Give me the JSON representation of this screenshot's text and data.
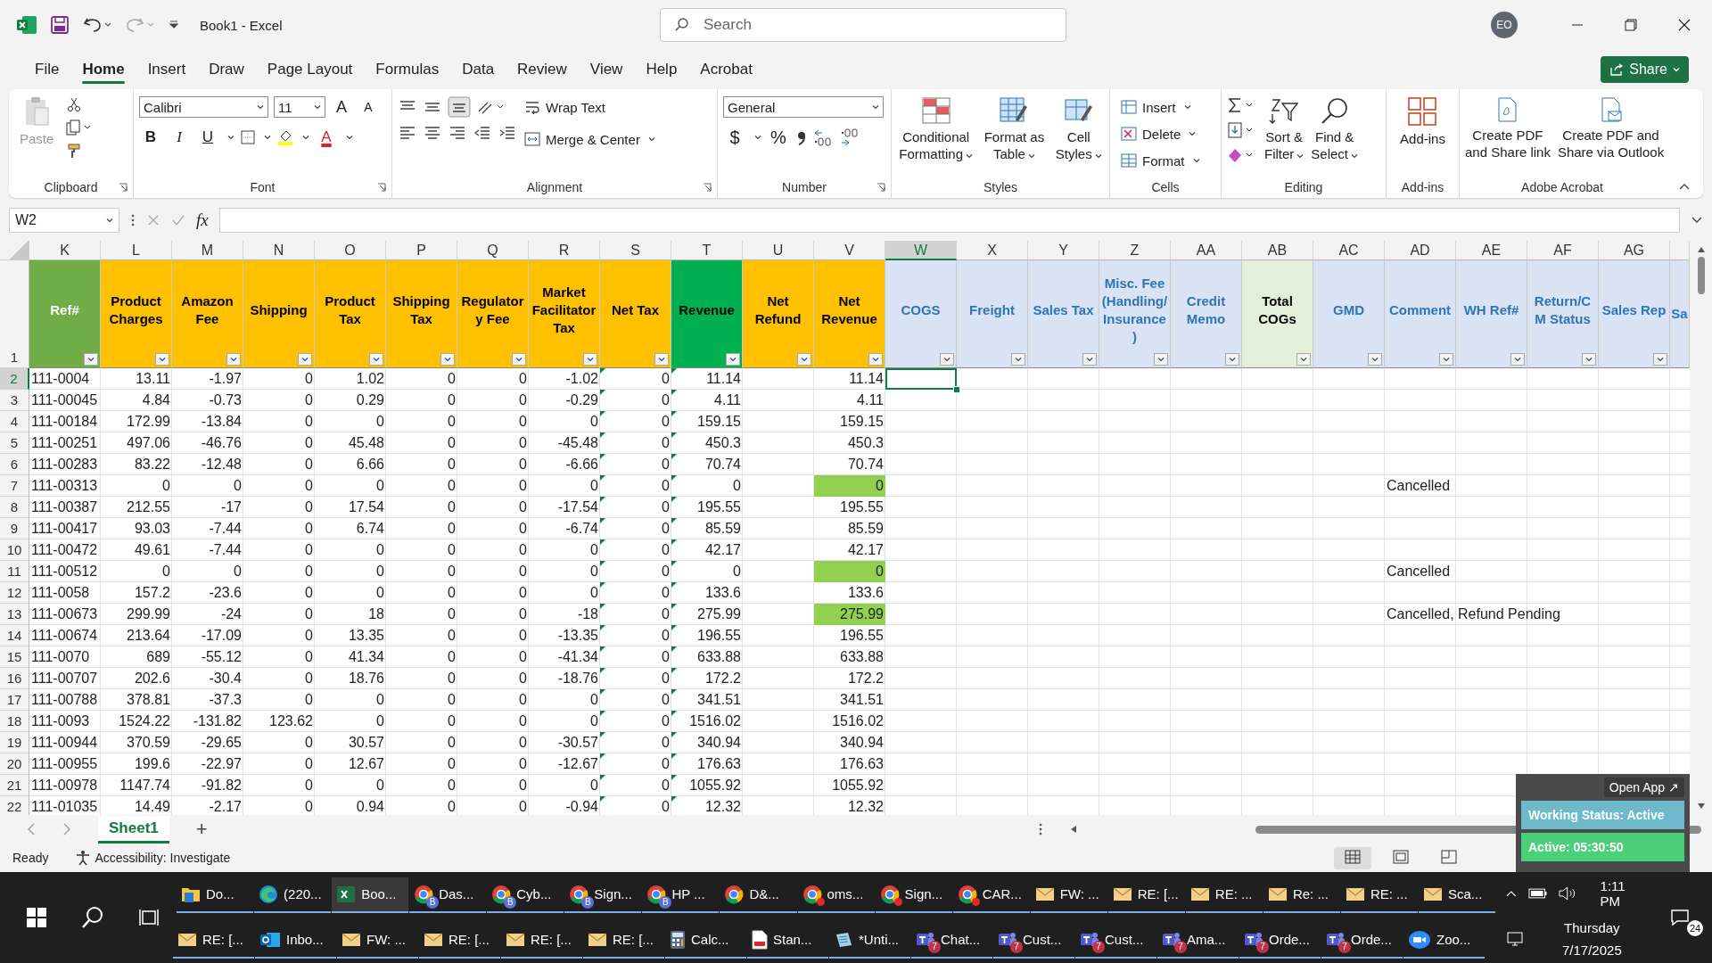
{
  "title_bar": {
    "title": "Book1  -  Excel",
    "search_placeholder": "Search",
    "avatar": "EO"
  },
  "menu_tabs": [
    {
      "label": "File",
      "selected": false
    },
    {
      "label": "Home",
      "selected": true
    },
    {
      "label": "Insert",
      "selected": false
    },
    {
      "label": "Draw",
      "selected": false
    },
    {
      "label": "Page Layout",
      "selected": false
    },
    {
      "label": "Formulas",
      "selected": false
    },
    {
      "label": "Data",
      "selected": false
    },
    {
      "label": "Review",
      "selected": false
    },
    {
      "label": "View",
      "selected": false
    },
    {
      "label": "Help",
      "selected": false
    },
    {
      "label": "Acrobat",
      "selected": false
    }
  ],
  "share": "Share",
  "ribbon": {
    "clipboard": {
      "label": "Clipboard",
      "paste": "Paste"
    },
    "font": {
      "label": "Font",
      "family": "Calibri",
      "size": "11",
      "grow": "A",
      "shrink": "A",
      "bold": "B",
      "italic": "I",
      "underline": "U",
      "font_color": "A"
    },
    "alignment": {
      "label": "Alignment",
      "wrap_text": "Wrap Text",
      "merge_center": "Merge & Center"
    },
    "number": {
      "label": "Number",
      "format": "General",
      "currency": "$",
      "percent": "%"
    },
    "styles": {
      "label": "Styles",
      "buttons": [
        {
          "lines": [
            "Conditional",
            "Formatting"
          ]
        },
        {
          "lines": [
            "Format as",
            "Table"
          ]
        },
        {
          "lines": [
            "Cell",
            "Styles"
          ]
        }
      ]
    },
    "cells": {
      "label": "Cells",
      "buttons": [
        "Insert",
        "Delete",
        "Format"
      ]
    },
    "editing": {
      "label": "Editing",
      "buttons": [
        {
          "lines": [
            "Sort &",
            "Filter"
          ]
        },
        {
          "lines": [
            "Find &",
            "Select"
          ]
        }
      ]
    },
    "addins": {
      "label": "Add-ins",
      "button": "Add-ins"
    },
    "acrobat": {
      "label": "Adobe Acrobat",
      "buttons": [
        {
          "lines": [
            "Create PDF",
            "and Share link"
          ]
        },
        {
          "lines": [
            "Create PDF and",
            "Share via Outlook"
          ]
        }
      ]
    }
  },
  "formula_bar": {
    "name_box": "W2",
    "fx": "fx"
  },
  "columns": [
    {
      "letter": "K",
      "header": "Ref#",
      "kind": "key",
      "color": "#70ad47",
      "selected": false
    },
    {
      "letter": "L",
      "header": "Product Charges",
      "kind": "amount",
      "color": "#ffc000",
      "selected": false
    },
    {
      "letter": "M",
      "header": "Amazon Fee",
      "kind": "amount",
      "color": "#ffc000",
      "selected": false
    },
    {
      "letter": "N",
      "header": "Shipping",
      "kind": "amount",
      "color": "#ffc000",
      "selected": false
    },
    {
      "letter": "O",
      "header": "Product Tax",
      "kind": "amount",
      "color": "#ffc000",
      "selected": false
    },
    {
      "letter": "P",
      "header": "Shipping Tax",
      "kind": "amount",
      "color": "#ffc000",
      "selected": false
    },
    {
      "letter": "Q",
      "header": "Regulatory Fee",
      "kind": "amount",
      "color": "#ffc000",
      "selected": false
    },
    {
      "letter": "R",
      "header": "Market Facilitator Tax",
      "kind": "amount",
      "color": "#ffc000",
      "selected": false
    },
    {
      "letter": "S",
      "header": "Net Tax",
      "kind": "amount",
      "color": "#ffc000",
      "selected": false,
      "error_indicator": true
    },
    {
      "letter": "T",
      "header": "Revenue",
      "kind": "amount",
      "color": "#00b050",
      "selected": false,
      "error_indicator": true
    },
    {
      "letter": "U",
      "header": "Net Refund",
      "kind": "amount",
      "color": "#ffc000",
      "selected": false
    },
    {
      "letter": "V",
      "header": "Net Revenue",
      "kind": "amount",
      "color": "#ffc000",
      "selected": false
    },
    {
      "letter": "W",
      "header": "COGS",
      "kind": "cost",
      "color": "#dae3f3",
      "selected": true
    },
    {
      "letter": "X",
      "header": "Freight",
      "kind": "cost",
      "color": "#dae3f3",
      "selected": false
    },
    {
      "letter": "Y",
      "header": "Sales Tax",
      "kind": "cost",
      "color": "#dae3f3",
      "selected": false
    },
    {
      "letter": "Z",
      "header": "Misc. Fee (Handling/Insurance)",
      "kind": "cost",
      "color": "#dae3f3",
      "selected": false
    },
    {
      "letter": "AA",
      "header": "Credit Memo",
      "kind": "cost",
      "color": "#dae3f3",
      "selected": false
    },
    {
      "letter": "AB",
      "header": "Total COGs",
      "kind": "total",
      "color": "#e2efda",
      "selected": false
    },
    {
      "letter": "AC",
      "header": "GMD",
      "kind": "cost",
      "color": "#dae3f3",
      "selected": false
    },
    {
      "letter": "AD",
      "header": "Comment",
      "kind": "cost",
      "color": "#dae3f3",
      "selected": false
    },
    {
      "letter": "AE",
      "header": "WH Ref#",
      "kind": "cost",
      "color": "#dae3f3",
      "selected": false
    },
    {
      "letter": "AF",
      "header": "Return/CM Status",
      "kind": "cost",
      "color": "#dae3f3",
      "selected": false
    },
    {
      "letter": "AG",
      "header": "Sales Rep",
      "kind": "cost",
      "color": "#dae3f3",
      "selected": false
    },
    {
      "header": "Sa",
      "kind": "cost",
      "color": "#dae3f3",
      "selected": false
    }
  ],
  "header_row": "1",
  "rows": [
    {
      "num": "2",
      "selected": true,
      "net_revenue_highlight": false,
      "cells": [
        "111-0004",
        "13.11",
        "-1.97",
        "0",
        "1.02",
        "0",
        "0",
        "-1.02",
        "0",
        "11.14",
        null,
        "11.14"
      ]
    },
    {
      "num": "3",
      "selected": false,
      "net_revenue_highlight": false,
      "cells": [
        "111-00045",
        "4.84",
        "-0.73",
        "0",
        "0.29",
        "0",
        "0",
        "-0.29",
        "0",
        "4.11",
        null,
        "4.11"
      ]
    },
    {
      "num": "4",
      "selected": false,
      "net_revenue_highlight": false,
      "cells": [
        "111-00184",
        "172.99",
        "-13.84",
        "0",
        "0",
        "0",
        "0",
        "0",
        "0",
        "159.15",
        null,
        "159.15"
      ]
    },
    {
      "num": "5",
      "selected": false,
      "net_revenue_highlight": false,
      "cells": [
        "111-00251",
        "497.06",
        "-46.76",
        "0",
        "45.48",
        "0",
        "0",
        "-45.48",
        "0",
        "450.3",
        null,
        "450.3"
      ]
    },
    {
      "num": "6",
      "selected": false,
      "net_revenue_highlight": false,
      "cells": [
        "111-00283",
        "83.22",
        "-12.48",
        "0",
        "6.66",
        "0",
        "0",
        "-6.66",
        "0",
        "70.74",
        null,
        "70.74"
      ]
    },
    {
      "num": "7",
      "selected": false,
      "net_revenue_highlight": true,
      "cells": [
        "111-00313",
        "0",
        "0",
        "0",
        "0",
        "0",
        "0",
        "0",
        "0",
        "0",
        null,
        "0"
      ],
      "comment": "Cancelled"
    },
    {
      "num": "8",
      "selected": false,
      "net_revenue_highlight": false,
      "cells": [
        "111-00387",
        "212.55",
        "-17",
        "0",
        "17.54",
        "0",
        "0",
        "-17.54",
        "0",
        "195.55",
        null,
        "195.55"
      ]
    },
    {
      "num": "9",
      "selected": false,
      "net_revenue_highlight": false,
      "cells": [
        "111-00417",
        "93.03",
        "-7.44",
        "0",
        "6.74",
        "0",
        "0",
        "-6.74",
        "0",
        "85.59",
        null,
        "85.59"
      ]
    },
    {
      "num": "10",
      "selected": false,
      "net_revenue_highlight": false,
      "cells": [
        "111-00472",
        "49.61",
        "-7.44",
        "0",
        "0",
        "0",
        "0",
        "0",
        "0",
        "42.17",
        null,
        "42.17"
      ]
    },
    {
      "num": "11",
      "selected": false,
      "net_revenue_highlight": true,
      "cells": [
        "111-00512",
        "0",
        "0",
        "0",
        "0",
        "0",
        "0",
        "0",
        "0",
        "0",
        null,
        "0"
      ],
      "comment": "Cancelled"
    },
    {
      "num": "12",
      "selected": false,
      "net_revenue_highlight": false,
      "cells": [
        "111-0058",
        "157.2",
        "-23.6",
        "0",
        "0",
        "0",
        "0",
        "0",
        "0",
        "133.6",
        null,
        "133.6"
      ]
    },
    {
      "num": "13",
      "selected": false,
      "net_revenue_highlight": true,
      "cells": [
        "111-00673",
        "299.99",
        "-24",
        "0",
        "18",
        "0",
        "0",
        "-18",
        "0",
        "275.99",
        null,
        "275.99"
      ],
      "comment": "Cancelled, Refund Pending"
    },
    {
      "num": "14",
      "selected": false,
      "net_revenue_highlight": false,
      "cells": [
        "111-00674",
        "213.64",
        "-17.09",
        "0",
        "13.35",
        "0",
        "0",
        "-13.35",
        "0",
        "196.55",
        null,
        "196.55"
      ]
    },
    {
      "num": "15",
      "selected": false,
      "net_revenue_highlight": false,
      "cells": [
        "111-0070",
        "689",
        "-55.12",
        "0",
        "41.34",
        "0",
        "0",
        "-41.34",
        "0",
        "633.88",
        null,
        "633.88"
      ]
    },
    {
      "num": "16",
      "selected": false,
      "net_revenue_highlight": false,
      "cells": [
        "111-00707",
        "202.6",
        "-30.4",
        "0",
        "18.76",
        "0",
        "0",
        "-18.76",
        "0",
        "172.2",
        null,
        "172.2"
      ]
    },
    {
      "num": "17",
      "selected": false,
      "net_revenue_highlight": false,
      "cells": [
        "111-00788",
        "378.81",
        "-37.3",
        "0",
        "0",
        "0",
        "0",
        "0",
        "0",
        "341.51",
        null,
        "341.51"
      ]
    },
    {
      "num": "18",
      "selected": false,
      "net_revenue_highlight": false,
      "cells": [
        "111-0093",
        "1524.22",
        "-131.82",
        "123.62",
        "0",
        "0",
        "0",
        "0",
        "0",
        "1516.02",
        null,
        "1516.02"
      ]
    },
    {
      "num": "19",
      "selected": false,
      "net_revenue_highlight": false,
      "cells": [
        "111-00944",
        "370.59",
        "-29.65",
        "0",
        "30.57",
        "0",
        "0",
        "-30.57",
        "0",
        "340.94",
        null,
        "340.94"
      ]
    },
    {
      "num": "20",
      "selected": false,
      "net_revenue_highlight": false,
      "cells": [
        "111-00955",
        "199.6",
        "-22.97",
        "0",
        "12.67",
        "0",
        "0",
        "-12.67",
        "0",
        "176.63",
        null,
        "176.63"
      ]
    },
    {
      "num": "21",
      "selected": false,
      "net_revenue_highlight": false,
      "cells": [
        "111-00978",
        "1147.74",
        "-91.82",
        "0",
        "0",
        "0",
        "0",
        "0",
        "0",
        "1055.92",
        null,
        "1055.92"
      ]
    },
    {
      "num": "22",
      "selected": false,
      "net_revenue_highlight": false,
      "cells": [
        "111-01035",
        "14.49",
        "-2.17",
        "0",
        "0.94",
        "0",
        "0",
        "-0.94",
        "0",
        "12.32",
        null,
        "12.32"
      ]
    }
  ],
  "sheet_tabs": [
    {
      "label": "Sheet1",
      "selected": true
    }
  ],
  "add_sheet": "+",
  "status_bar": {
    "ready": "Ready",
    "accessibility": "Accessibility: Investigate"
  },
  "overlay": {
    "open_app": "Open App ↗",
    "working_status": "Working Status: Active",
    "active_time": "Active: 05:30:50"
  },
  "taskbar": {
    "top_row": [
      {
        "label": "Do...",
        "kind": "folder",
        "selected": false,
        "alert": false
      },
      {
        "label": "(220...",
        "kind": "edge",
        "selected": false,
        "alert": false
      },
      {
        "label": "Boo...",
        "kind": "excel",
        "selected": true,
        "alert": false
      },
      {
        "label": "Das...",
        "kind": "chrome",
        "selected": false,
        "alert": false,
        "badge": "B"
      },
      {
        "label": "Cyb...",
        "kind": "chrome",
        "selected": false,
        "alert": false,
        "badge": "B"
      },
      {
        "label": "Sign...",
        "kind": "chrome",
        "selected": false,
        "alert": false,
        "badge": "B"
      },
      {
        "label": "HP ...",
        "kind": "chrome",
        "selected": false,
        "alert": false,
        "badge": "B"
      },
      {
        "label": "D&...",
        "kind": "chrome",
        "selected": false,
        "alert": false
      },
      {
        "label": "oms...",
        "kind": "chrome",
        "selected": false,
        "alert": true
      },
      {
        "label": "Sign...",
        "kind": "chrome",
        "selected": false,
        "alert": true
      },
      {
        "label": "CAR...",
        "kind": "chrome",
        "selected": false,
        "alert": true
      },
      {
        "label": "FW: ...",
        "kind": "mail",
        "selected": false,
        "alert": false
      },
      {
        "label": "RE: [...",
        "kind": "mail",
        "selected": false,
        "alert": false
      },
      {
        "label": "RE: ...",
        "kind": "mail",
        "selected": false,
        "alert": false
      },
      {
        "label": "Re: ...",
        "kind": "mail",
        "selected": false,
        "alert": false
      },
      {
        "label": "RE: ...",
        "kind": "mail",
        "selected": false,
        "alert": false
      },
      {
        "label": "Sca...",
        "kind": "mail",
        "selected": false,
        "alert": false
      }
    ],
    "bottom_row": [
      {
        "label": "RE: [...",
        "kind": "mail",
        "selected": false,
        "alert": false
      },
      {
        "label": "Inbo...",
        "kind": "outlook",
        "selected": false,
        "alert": false
      },
      {
        "label": "FW: ...",
        "kind": "mail",
        "selected": false,
        "alert": false
      },
      {
        "label": "RE: [...",
        "kind": "mail",
        "selected": false,
        "alert": false
      },
      {
        "label": "RE: [...",
        "kind": "mail",
        "selected": false,
        "alert": false
      },
      {
        "label": "RE: [...",
        "kind": "mail",
        "selected": false,
        "alert": false
      },
      {
        "label": "Calc...",
        "kind": "calculator",
        "selected": false,
        "alert": false
      },
      {
        "label": "Stan...",
        "kind": "pdf",
        "selected": false,
        "alert": false
      },
      {
        "label": "*Unti...",
        "kind": "notepad",
        "selected": false,
        "alert": false
      },
      {
        "label": "Chat...",
        "kind": "teams",
        "selected": false,
        "alert": false,
        "badge": "7"
      },
      {
        "label": "Cust...",
        "kind": "teams",
        "selected": false,
        "alert": false,
        "badge": "7"
      },
      {
        "label": "Cust...",
        "kind": "teams",
        "selected": false,
        "alert": false,
        "badge": "7"
      },
      {
        "label": "Ama...",
        "kind": "teams",
        "selected": false,
        "alert": false,
        "badge": "7"
      },
      {
        "label": "Orde...",
        "kind": "teams",
        "selected": false,
        "alert": false,
        "badge": "7"
      },
      {
        "label": "Orde...",
        "kind": "teams",
        "selected": false,
        "alert": false,
        "badge": "7"
      },
      {
        "label": "Zoo...",
        "kind": "zoom",
        "selected": false,
        "alert": false
      }
    ],
    "time": "1:11 PM",
    "day": "Thursday",
    "date": "7/17/2025",
    "notifications": "24"
  }
}
